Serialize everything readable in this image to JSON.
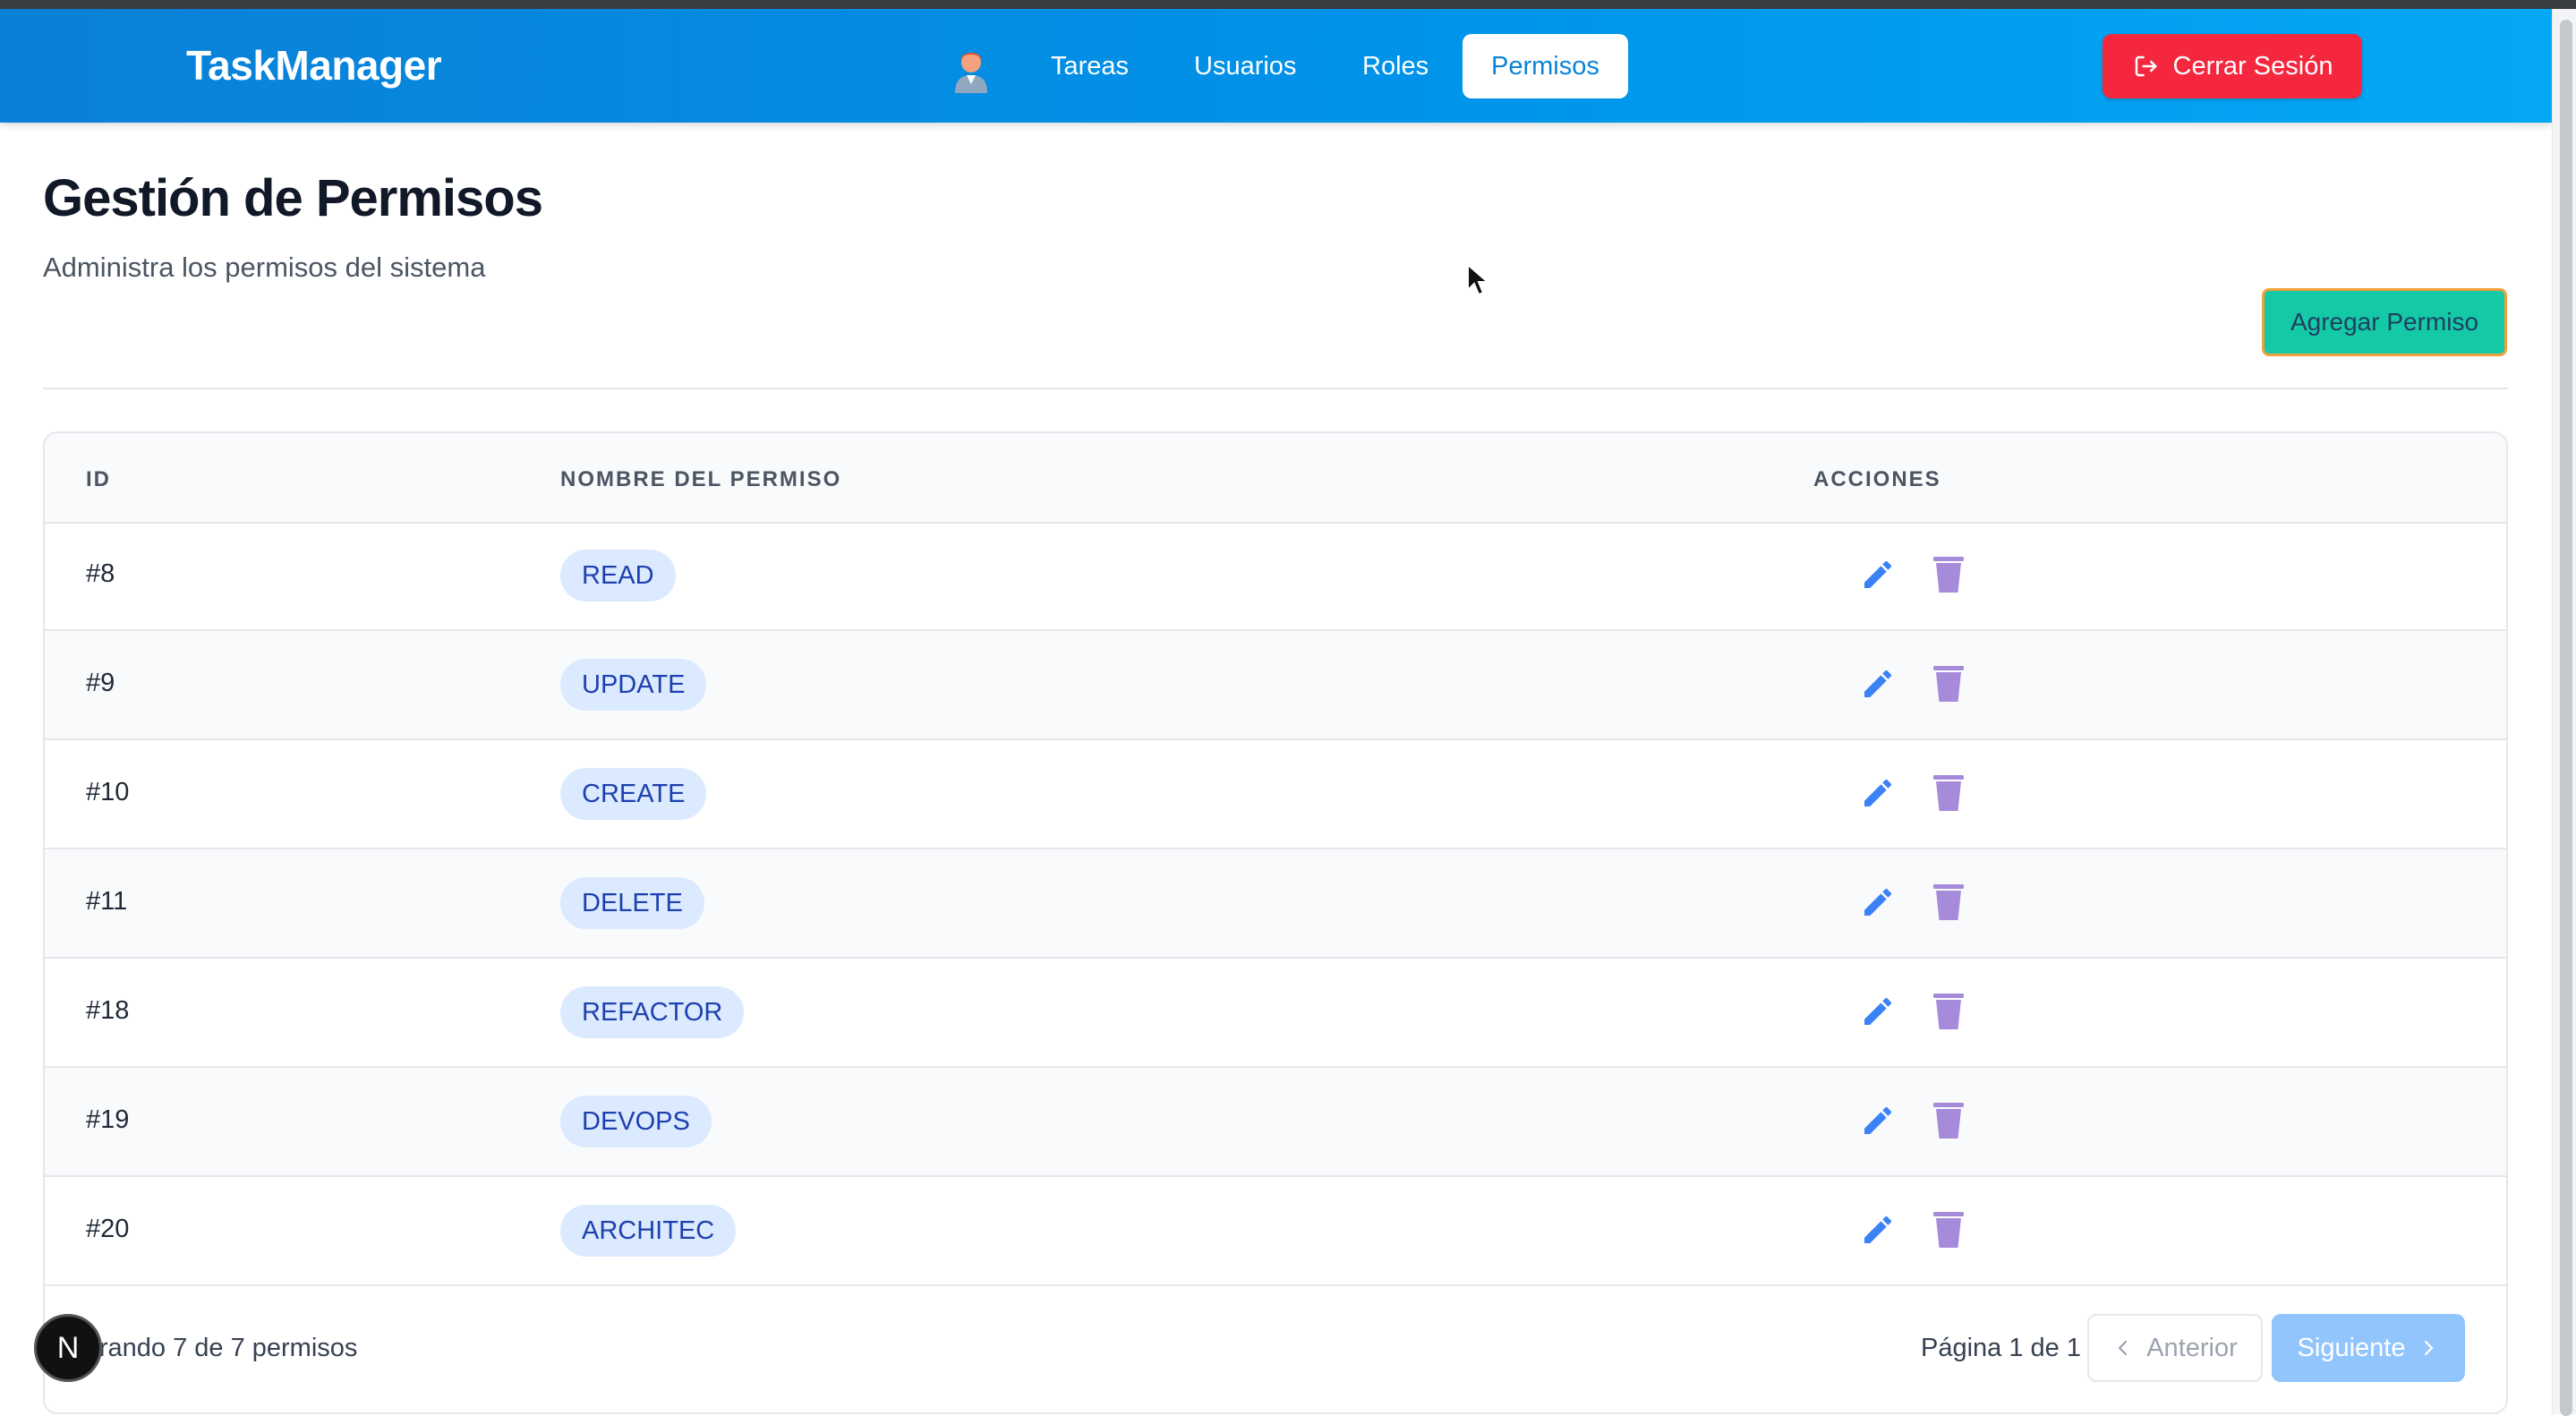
{
  "app": {
    "brand": "TaskManager"
  },
  "nav": {
    "avatar_icon": "user-avatar-icon",
    "items": [
      {
        "label": "Tareas",
        "active": false
      },
      {
        "label": "Usuarios",
        "active": false
      },
      {
        "label": "Roles",
        "active": false
      },
      {
        "label": "Permisos",
        "active": true
      }
    ],
    "logout_label": "Cerrar Sesión",
    "logout_icon": "logout-icon"
  },
  "header": {
    "title": "Gestión de Permisos",
    "subtitle": "Administra los permisos del sistema",
    "add_button": "Agregar Permiso"
  },
  "table": {
    "columns": [
      "ID",
      "NOMBRE DEL PERMISO",
      "ACCIONES"
    ],
    "rows": [
      {
        "id": "#8",
        "name": "READ"
      },
      {
        "id": "#9",
        "name": "UPDATE"
      },
      {
        "id": "#10",
        "name": "CREATE"
      },
      {
        "id": "#11",
        "name": "DELETE"
      },
      {
        "id": "#18",
        "name": "REFACTOR"
      },
      {
        "id": "#19",
        "name": "DEVOPS"
      },
      {
        "id": "#20",
        "name": "ARCHITEC"
      }
    ]
  },
  "footer": {
    "showing": "Mostrando 7 de 7 permisos",
    "page_info": "Página 1 de 1",
    "prev_label": "Anterior",
    "next_label": "Siguiente"
  },
  "dev_badge": "N",
  "colors": {
    "nav_gradient_start": "#0a80d6",
    "nav_gradient_end": "#04a8f5",
    "logout": "#f5273e",
    "add_button": "#14c9a6",
    "badge_bg": "#dbeafe",
    "badge_text": "#1e40af",
    "edit_icon": "#3b82f6",
    "trash_icon": "#a78bdb"
  }
}
